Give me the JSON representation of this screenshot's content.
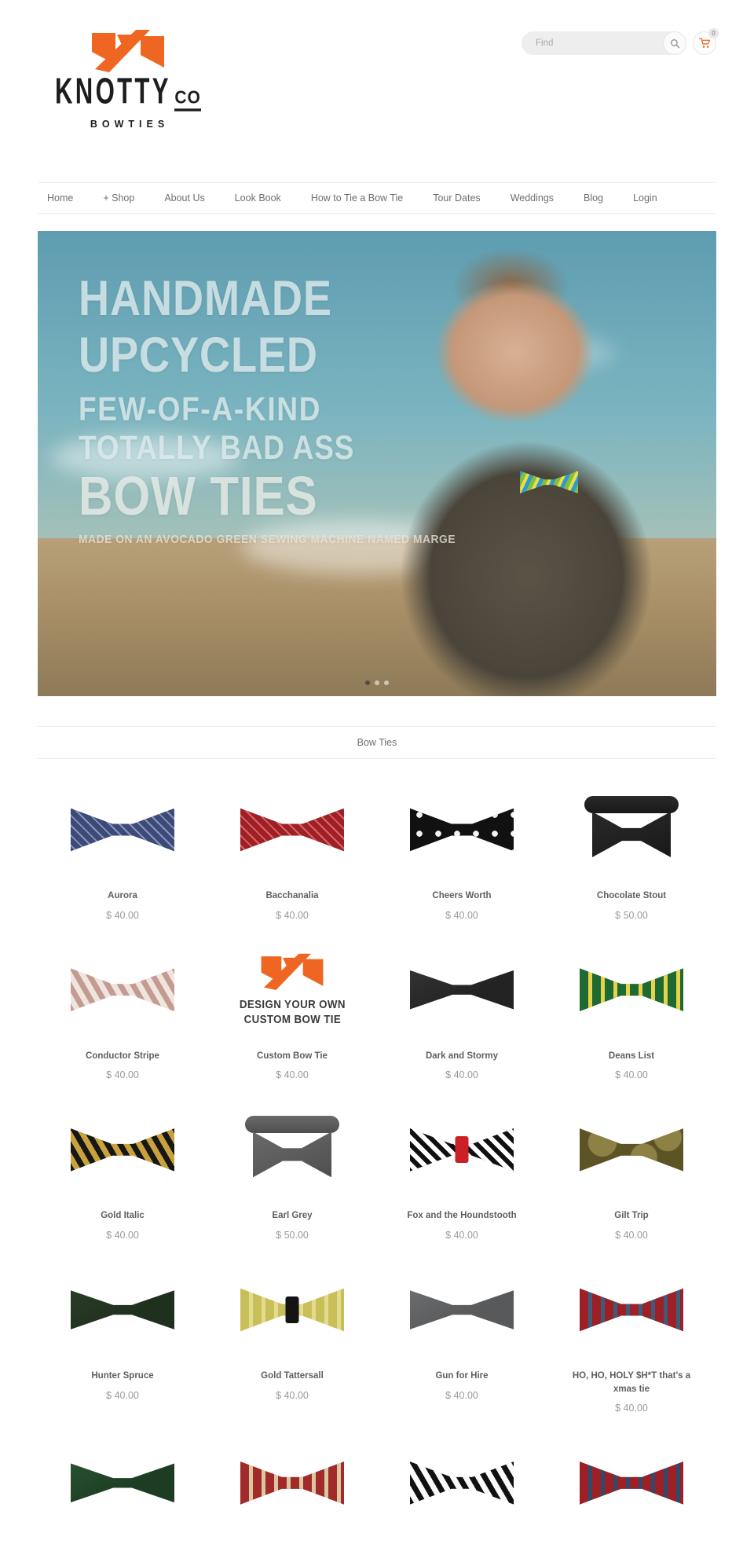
{
  "brand": {
    "name_main": "KNOTTY",
    "name_suffix": "CO",
    "subtitle": "BOWTIES",
    "accent_color": "#ef6622"
  },
  "search": {
    "placeholder": "Find",
    "value": "",
    "icon": "search-icon"
  },
  "cart": {
    "count": "0",
    "icon": "shopping-cart-icon"
  },
  "nav": {
    "items": [
      {
        "label": "Home"
      },
      {
        "label": "+ Shop"
      },
      {
        "label": "About Us"
      },
      {
        "label": "Look Book"
      },
      {
        "label": "How to Tie a Bow Tie"
      },
      {
        "label": "Tour Dates"
      },
      {
        "label": "Weddings"
      },
      {
        "label": "Blog"
      },
      {
        "label": "Login"
      }
    ]
  },
  "hero": {
    "line1": "HANDMADE",
    "line2": "UPCYCLED",
    "line3": "FEW-OF-A-KIND",
    "line4": "TOTALLY BAD ASS",
    "line5": "BOW TIES",
    "tagline": "MADE ON AN AVOCADO GREEN SEWING MACHINE NAMED MARGE",
    "slides": 3,
    "active_slide": 1
  },
  "section": {
    "title": "Bow Ties"
  },
  "products": [
    {
      "name": "Aurora",
      "price": "$ 40.00",
      "style": "bow",
      "c1": "#3b4a77",
      "c2": "#8b93bb",
      "pattern": "diamond"
    },
    {
      "name": "Bacchanalia",
      "price": "$ 40.00",
      "style": "bow",
      "c1": "#9e1f24",
      "c2": "#d9636a",
      "pattern": "diamond"
    },
    {
      "name": "Cheers Worth",
      "price": "$ 40.00",
      "style": "bow",
      "c1": "#111111",
      "c2": "#f2f2ee",
      "pattern": "dots"
    },
    {
      "name": "Chocolate Stout",
      "price": "$ 50.00",
      "style": "collar",
      "c1": "#191919",
      "c2": "#2a2a2a",
      "pattern": "solid"
    },
    {
      "name": "Conductor Stripe",
      "price": "$ 40.00",
      "style": "bow",
      "c1": "#c39b90",
      "c2": "#f0e4de",
      "pattern": "stripe"
    },
    {
      "name": "Custom Bow Tie",
      "price": "$ 40.00",
      "style": "custom",
      "custom_line1": "DESIGN YOUR OWN",
      "custom_line2": "CUSTOM BOW TIE"
    },
    {
      "name": "Dark and Stormy",
      "price": "$ 40.00",
      "style": "bow",
      "c1": "#232323",
      "c2": "#343434",
      "pattern": "solid"
    },
    {
      "name": "Deans List",
      "price": "$ 40.00",
      "style": "bow",
      "c1": "#1d6b33",
      "c2": "#e8d24a",
      "pattern": "plaid"
    },
    {
      "name": "Gold Italic",
      "price": "$ 40.00",
      "style": "bow",
      "c1": "#171717",
      "c2": "#c9a23b",
      "pattern": "stripe"
    },
    {
      "name": "Earl Grey",
      "price": "$ 50.00",
      "style": "collar",
      "c1": "#4f4f4f",
      "c2": "#6a6a6a",
      "pattern": "solid"
    },
    {
      "name": "Fox and the Houndstooth",
      "price": "$ 40.00",
      "style": "bow",
      "c1": "#101010",
      "c2": "#ffffff",
      "pattern": "houndstooth",
      "knot": "#cc2027"
    },
    {
      "name": "Gilt Trip",
      "price": "$ 40.00",
      "style": "bow",
      "c1": "#5d5426",
      "c2": "#8d8145",
      "pattern": "camo"
    },
    {
      "name": "Hunter Spruce",
      "price": "$ 40.00",
      "style": "bow",
      "c1": "#20301f",
      "c2": "#2b3d28",
      "pattern": "solid"
    },
    {
      "name": "Gold Tattersall",
      "price": "$ 40.00",
      "style": "bow",
      "c1": "#c9bf59",
      "c2": "#e3dc8e",
      "pattern": "plaid",
      "knot": "#141414"
    },
    {
      "name": "Gun for Hire",
      "price": "$ 40.00",
      "style": "bow",
      "c1": "#57595b",
      "c2": "#6c6e70",
      "pattern": "solid"
    },
    {
      "name": "HO, HO, HOLY $H*T that's a xmas tie",
      "price": "$ 40.00",
      "style": "bow",
      "c1": "#9c2026",
      "c2": "#3d5c7a",
      "pattern": "plaid"
    },
    {
      "name": "",
      "price": "",
      "style": "bow",
      "c1": "#1c3d24",
      "c2": "#2a5231",
      "pattern": "solid"
    },
    {
      "name": "",
      "price": "",
      "style": "bow",
      "c1": "#a32a2a",
      "c2": "#d9c7a0",
      "pattern": "plaid"
    },
    {
      "name": "",
      "price": "",
      "style": "bow",
      "c1": "#111111",
      "c2": "#fafafa",
      "pattern": "stripe"
    },
    {
      "name": "",
      "price": "",
      "style": "bow",
      "c1": "#9c2026",
      "c2": "#2f4a6b",
      "pattern": "plaid"
    }
  ]
}
